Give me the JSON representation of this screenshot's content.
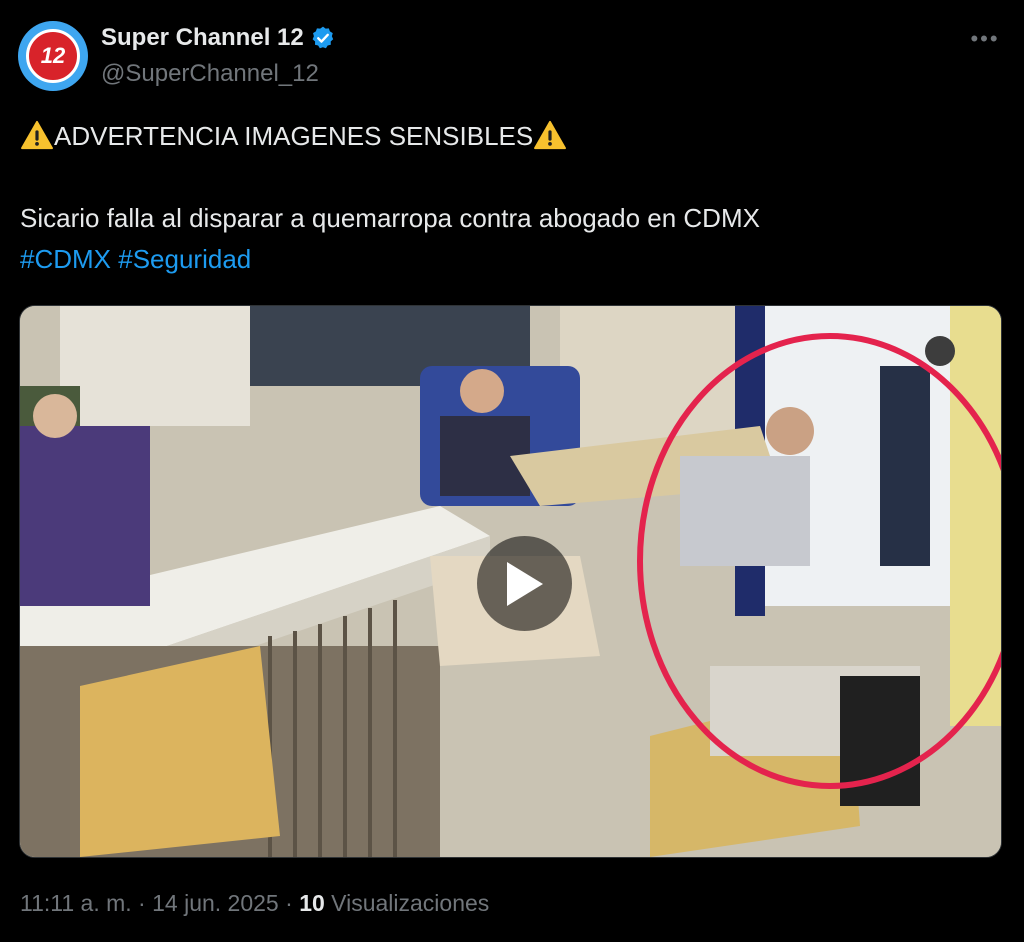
{
  "author": {
    "display_name": "Super Channel 12",
    "handle": "@SuperChannel_12",
    "avatar_text": "12",
    "verified": true
  },
  "tweet": {
    "line1": "ADVERTENCIA IMAGENES SENSIBLES",
    "line2": "Sicario falla al disparar a quemarropa contra abogado en CDMX",
    "hashtags": [
      "#CDMX",
      "#Seguridad"
    ]
  },
  "media": {
    "type": "video",
    "icon": "play-icon"
  },
  "meta": {
    "time": "11:11 a. m.",
    "date": "14 jun. 2025",
    "views_count": "10",
    "views_label": "Visualizaciones",
    "separator": "·"
  },
  "colors": {
    "background": "#000000",
    "text": "#e7e9ea",
    "secondary": "#71767b",
    "link": "#1d9bf0",
    "verified": "#1d9bf0"
  }
}
